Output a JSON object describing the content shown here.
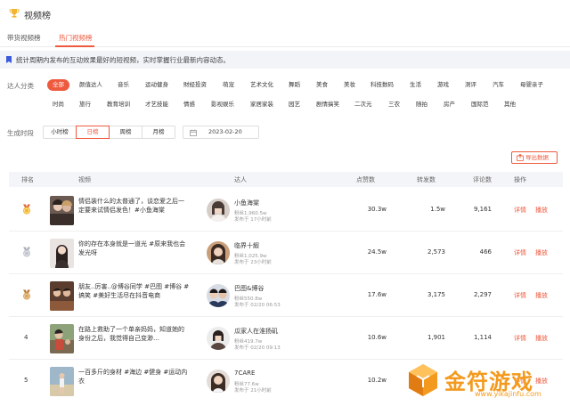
{
  "header": {
    "title": "视频榜"
  },
  "tabs": [
    {
      "label": "带货视频榜"
    },
    {
      "label": "热门视频榜"
    }
  ],
  "notice": {
    "text": "统计周期内发布的互动效果最好的短视频，实时掌握行业最新内容动态。"
  },
  "filters": {
    "category_label": "达人分类",
    "categories_row1": [
      "全部",
      "颜值达人",
      "音乐",
      "运动健身",
      "財经投资",
      "萌宠",
      "艺术文化",
      "舞蹈",
      "美食",
      "美妆",
      "科技数码",
      "生活",
      "游戏",
      "测评",
      "汽车",
      "母婴亲子"
    ],
    "categories_row2": [
      "时尚",
      "旅行",
      "教育培训",
      "才艺技能",
      "情感",
      "影视娱乐",
      "家居家装",
      "园艺",
      "剧情搞笑",
      "二次元",
      "三农",
      "随拍",
      "房产",
      "国际范",
      "其他"
    ],
    "active_category": "全部",
    "period_label": "生成时段",
    "periods": [
      "小时榜",
      "日榜",
      "周榜",
      "月榜"
    ],
    "active_period": "日榜",
    "date": "2023-02-20"
  },
  "export_label": "导出数据",
  "table": {
    "headers": [
      "排名",
      "视频",
      "达人",
      "点赞数",
      "转发数",
      "评论数",
      "操作"
    ],
    "actions": {
      "detail": "详情",
      "play": "播放"
    },
    "rows": [
      {
        "rank": "1",
        "medal": "gold",
        "title": "情侣装什么的太普通了，谈恋爱之后一定要来试情侣发色！#小鱼海棠",
        "influencer": "小鱼海棠",
        "fans": "粉丝1,960.5w",
        "published": "发布于 17小时前",
        "likes": "30.3w",
        "shares": "1.5w",
        "comments": "9,161"
      },
      {
        "rank": "2",
        "medal": "silver",
        "title": "你的存在本身就是一道光 #原来我也会发光呀",
        "influencer": "临界十縀",
        "fans": "粉丝1,025.9w",
        "published": "发布于 23小时前",
        "likes": "24.5w",
        "shares": "2,573",
        "comments": "466"
      },
      {
        "rank": "3",
        "medal": "bronze",
        "title": "朋友..厉害..@博谷同学 #巴图 #博谷 #搞笑 #美好生活尽在抖音电商",
        "influencer": "巴图&博谷",
        "fans": "粉丝550.8w",
        "published": "发布于 02/20 06:53",
        "likes": "17.6w",
        "shares": "3,175",
        "comments": "2,297"
      },
      {
        "rank": "4",
        "medal": "",
        "title": "在路上救助了一个单亲妈妈，知道她的身份之后，我觉得自己变渺…",
        "influencer": "瓜家人在淮扬矶",
        "fans": "粉丝419.7w",
        "published": "发布于 02/20 09:13",
        "likes": "10.6w",
        "shares": "1,901",
        "comments": "1,114"
      },
      {
        "rank": "5",
        "medal": "",
        "title": "一百多斤的身材 #海边 #健身 #运动内衣",
        "influencer": "7CARE",
        "fans": "粉丝77.6w",
        "published": "发布于 21小时前",
        "likes": "10.2w",
        "shares": "",
        "comments": ""
      }
    ]
  },
  "watermark": {
    "text": "金符游戏",
    "url": "www.yikajinfu.com"
  },
  "colors": {
    "accent": "#ee5a3e",
    "gold": "#f2b632",
    "silver": "#c2c6cc",
    "bronze": "#d7a55e",
    "watermark": "#f39a1e"
  }
}
